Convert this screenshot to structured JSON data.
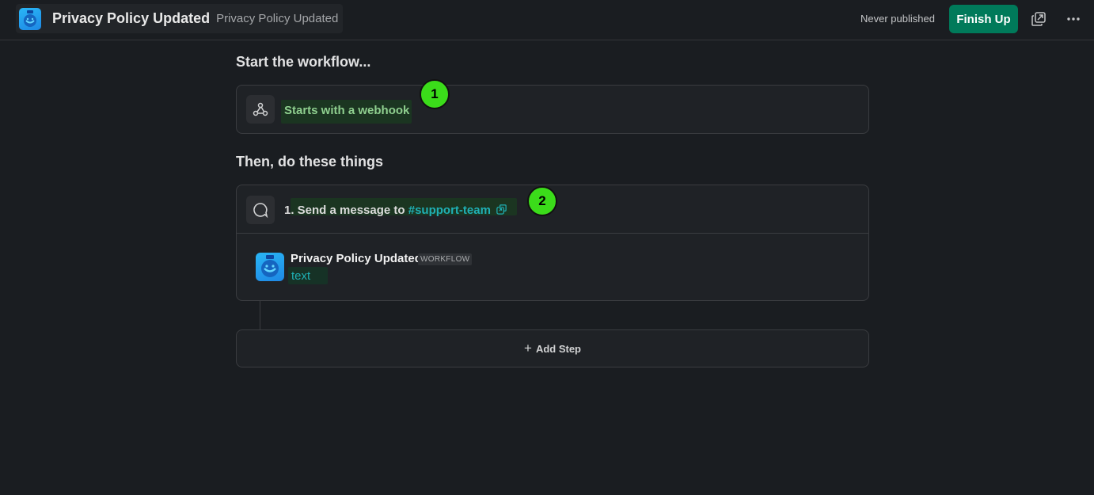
{
  "header": {
    "title": "Privacy Policy Updated",
    "subtitle": "Privacy Policy Updated",
    "status": "Never published",
    "finish_label": "Finish Up",
    "icons": {
      "logo": "workflow-robot-icon",
      "preview": "open-preview-icon",
      "more": "more-horizontal-icon"
    }
  },
  "trigger": {
    "heading": "Start the workflow...",
    "label": "Starts with a webhook",
    "icon": "webhook-icon",
    "badge": "1"
  },
  "steps": {
    "heading": "Then, do these things",
    "items": [
      {
        "prefix": "1. Send a message to",
        "channel_symbol": "#",
        "channel": "support-team",
        "icon": "message-bubble-icon",
        "badge": "2",
        "preview": {
          "sender": "Privacy Policy Updated",
          "tag": "WORKFLOW",
          "text": "text"
        }
      }
    ]
  },
  "add_step": {
    "label": "Add Step"
  },
  "colors": {
    "background": "#1a1d21",
    "finish_button": "#007a5a",
    "badge": "#3bdc1a",
    "channel": "#1fb0b5",
    "trigger_text": "#8fcf8f"
  }
}
